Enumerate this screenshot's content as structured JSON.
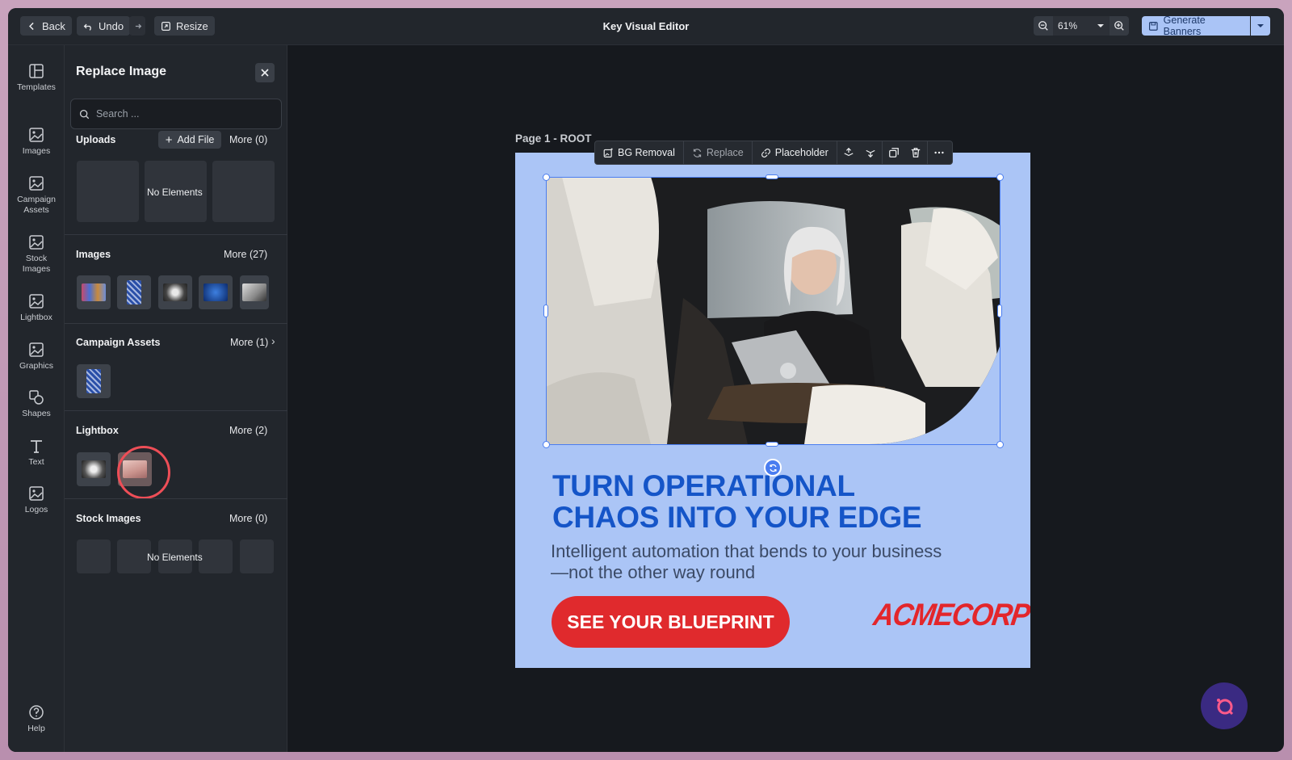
{
  "topbar": {
    "back_label": "Back",
    "undo_label": "Undo",
    "resize_label": "Resize",
    "app_title": "Key Visual Editor",
    "zoom_value": "61%",
    "generate_label": "Generate Banners"
  },
  "rail": {
    "items": [
      {
        "label": "Templates",
        "icon": "template-icon"
      },
      {
        "label": "Images",
        "icon": "image-icon"
      },
      {
        "label": "Campaign Assets",
        "icon": "image-icon"
      },
      {
        "label": "Stock Images",
        "icon": "image-icon"
      },
      {
        "label": "Lightbox",
        "icon": "image-icon"
      },
      {
        "label": "Graphics",
        "icon": "image-icon"
      },
      {
        "label": "Shapes",
        "icon": "shapes-icon"
      },
      {
        "label": "Text",
        "icon": "text-icon"
      },
      {
        "label": "Logos",
        "icon": "image-icon"
      }
    ],
    "help_label": "Help"
  },
  "panel": {
    "title": "Replace Image",
    "search_placeholder": "Search ...",
    "uploads": {
      "title": "Uploads",
      "add_label": "Add File",
      "more_label": "More (0)",
      "empty_label": "No Elements"
    },
    "images": {
      "title": "Images",
      "more_label": "More (27)"
    },
    "campaign_assets": {
      "title": "Campaign Assets",
      "more_label": "More (1)"
    },
    "lightbox": {
      "title": "Lightbox",
      "more_label": "More (2)"
    },
    "stock_images": {
      "title": "Stock Images",
      "more_label": "More (0)",
      "empty_label": "No Elements"
    }
  },
  "canvas": {
    "page_label": "Page 1 - ROOT",
    "toolbar": {
      "bg_removal": "BG Removal",
      "replace": "Replace",
      "placeholder": "Placeholder"
    },
    "headline_line1": "TURN OPERATIONAL",
    "headline_line2": "CHAOS INTO YOUR EDGE",
    "subline": "Intelligent automation that bends to your business—not the other way round",
    "cta_label": "SEE YOUR BLUEPRINT",
    "logo_text": "ACMECORP"
  },
  "colors": {
    "accent": "#aac4f6",
    "artboard_bg": "#abc5f6",
    "headline": "#1555c8",
    "cta": "#e02a2d",
    "selection": "#4a7df0",
    "highlight_ring": "#ee4e57"
  }
}
